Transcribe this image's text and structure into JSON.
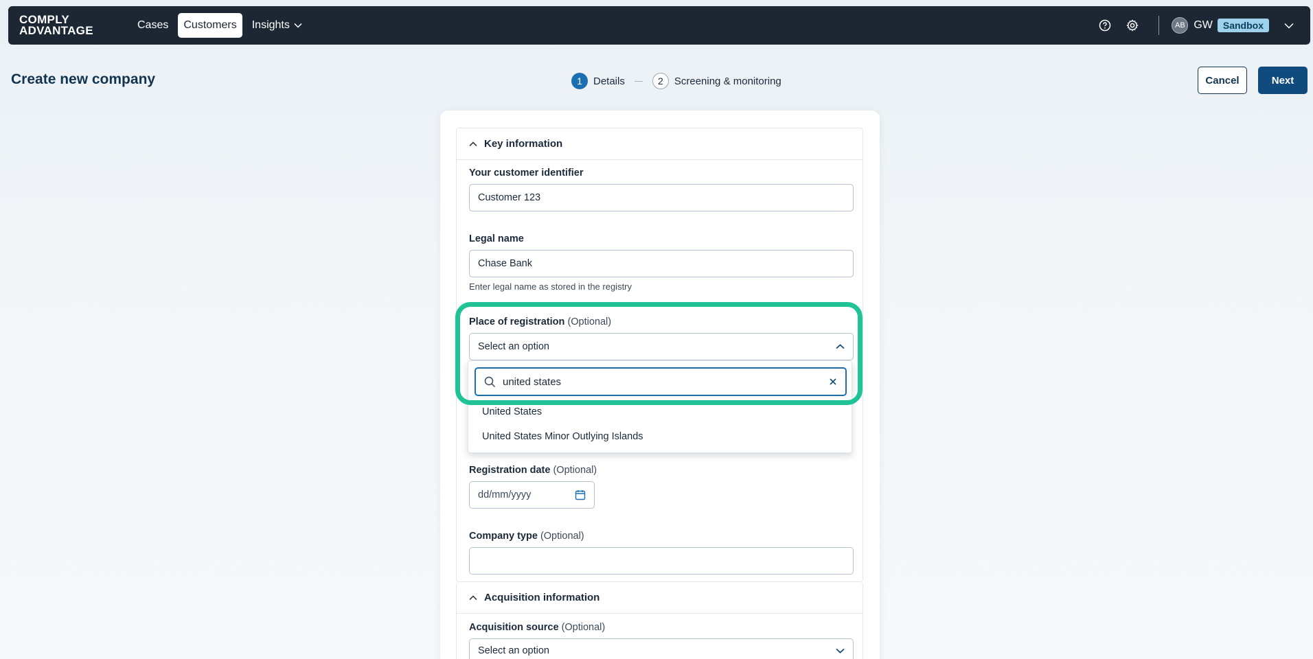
{
  "topbar": {
    "logo_line1": "COMPLY",
    "logo_line2": "ADVANTAGE",
    "nav": [
      {
        "label": "Cases"
      },
      {
        "label": "Customers"
      },
      {
        "label": "Insights"
      }
    ],
    "user_avatar": "AB",
    "user_initials": "GW",
    "env_badge": "Sandbox"
  },
  "header": {
    "title": "Create new company",
    "steps": [
      {
        "num": "1",
        "label": "Details"
      },
      {
        "num": "2",
        "label": "Screening & monitoring"
      }
    ],
    "cancel_label": "Cancel",
    "next_label": "Next"
  },
  "key_info": {
    "heading": "Key information",
    "customer_id_label": "Your customer identifier",
    "customer_id_value": "Customer 123",
    "legal_name_label": "Legal name",
    "legal_name_value": "Chase Bank",
    "legal_name_hint": "Enter legal name as stored in the registry",
    "place_label": "Place of registration",
    "optional": "(Optional)",
    "place_placeholder": "Select an option",
    "search_value": "united states",
    "options": [
      "United States",
      "United States Minor Outlying Islands"
    ],
    "reg_date_label": "Registration date",
    "reg_date_placeholder": "dd/mm/yyyy",
    "company_type_label": "Company type"
  },
  "acquisition": {
    "heading": "Acquisition information",
    "source_label": "Acquisition source",
    "source_placeholder": "Select an option"
  },
  "colors": {
    "topbar": "#1c2733",
    "primary": "#0f4c7d",
    "highlight": "#1fc395",
    "focus": "#1b6fb0"
  }
}
